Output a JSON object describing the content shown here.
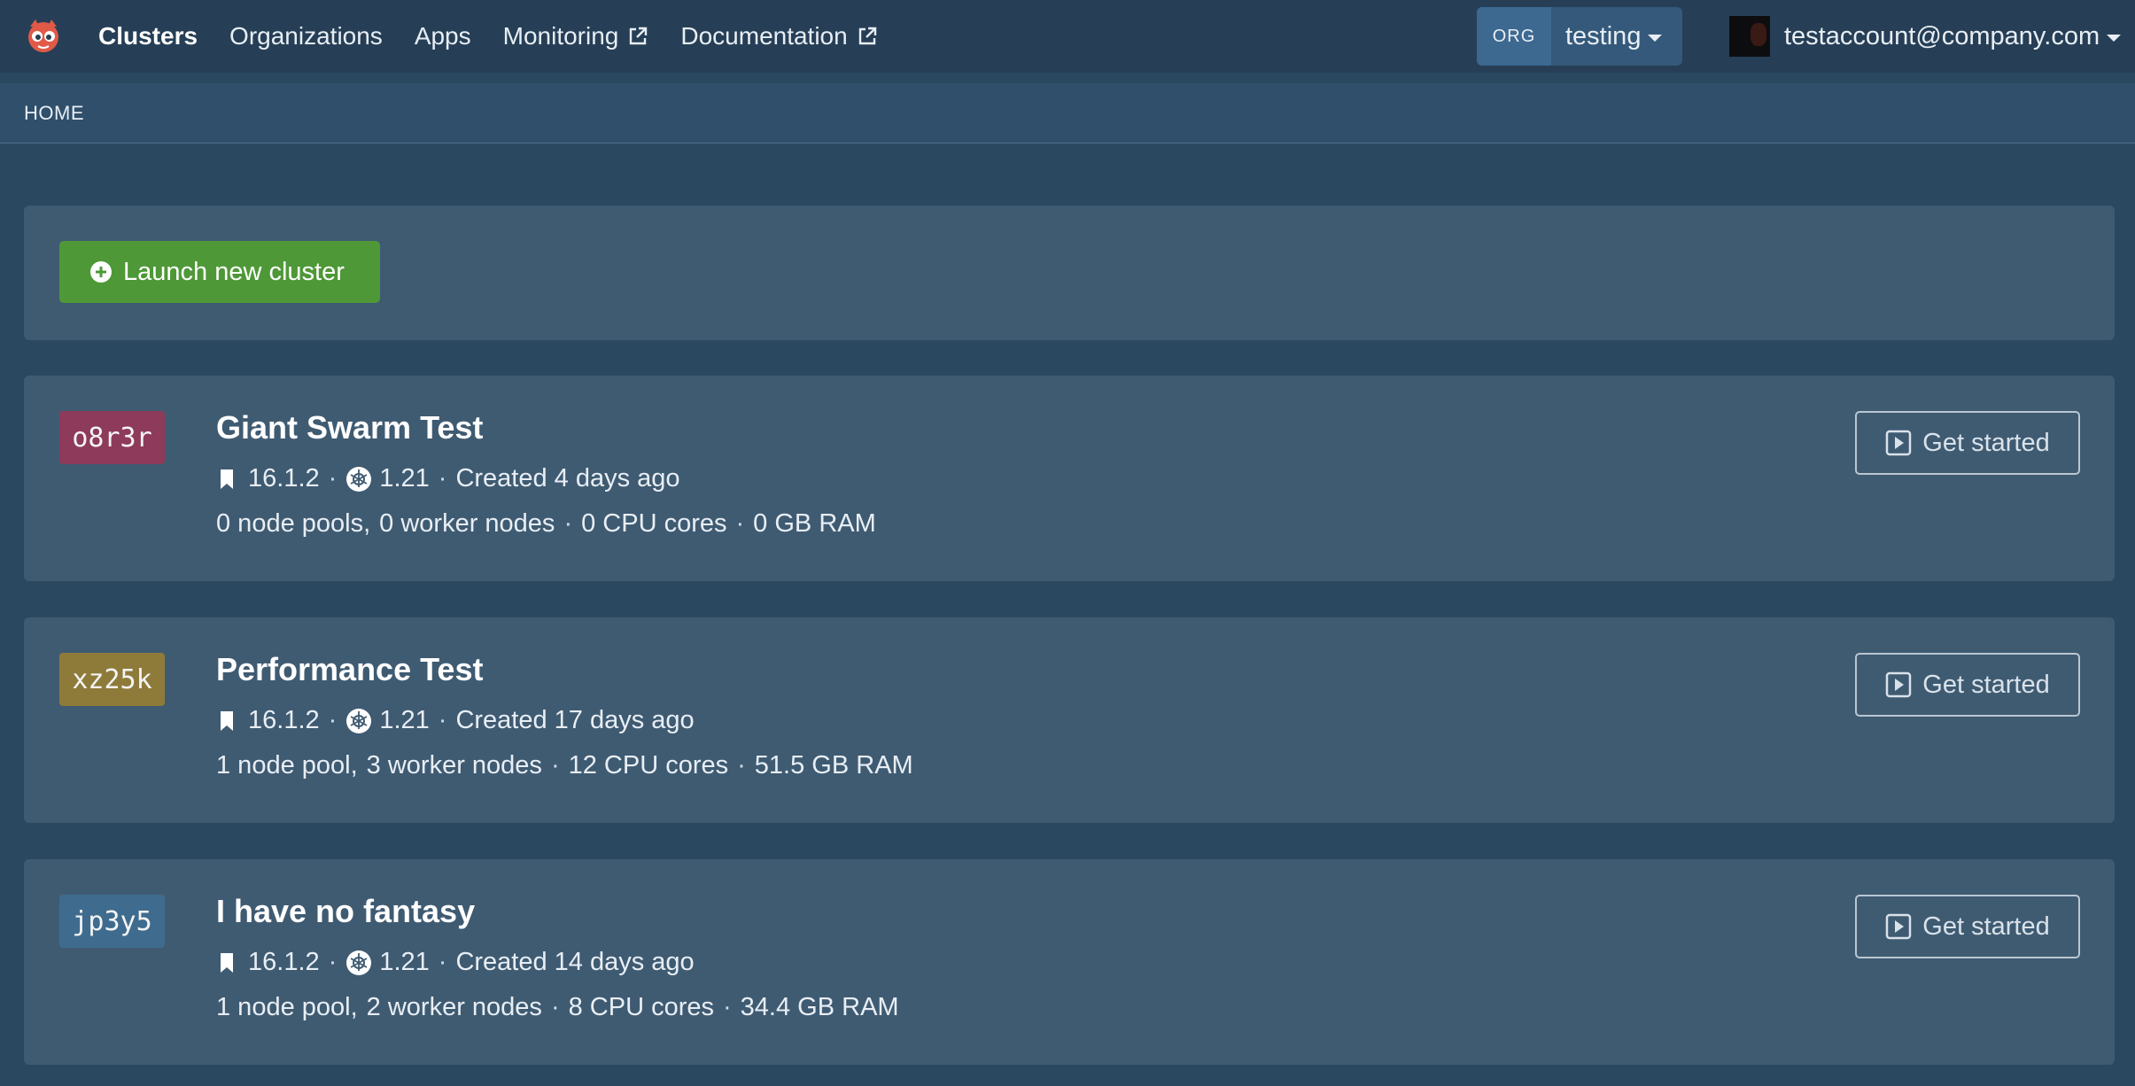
{
  "navbar": {
    "logo_icon": "giant-swarm-logo-icon",
    "links": [
      {
        "label": "Clusters",
        "active": true,
        "external": false
      },
      {
        "label": "Organizations",
        "active": false,
        "external": false
      },
      {
        "label": "Apps",
        "active": false,
        "external": false
      },
      {
        "label": "Monitoring",
        "active": false,
        "external": true
      },
      {
        "label": "Documentation",
        "active": false,
        "external": true
      }
    ],
    "org_badge": "ORG",
    "org_name": "testing",
    "user_email": "testaccount@company.com"
  },
  "breadcrumb": {
    "label": "HOME"
  },
  "launch": {
    "label": "Launch new cluster",
    "color": "#4e9837"
  },
  "clusters": [
    {
      "id": "o8r3r",
      "id_color": "#8e3a5a",
      "name": "Giant Swarm Test",
      "release": "16.1.2",
      "k8s": "1.21",
      "created": "Created 4 days ago",
      "node_pools": "0 node pools,",
      "worker_nodes": "0 worker nodes",
      "cpu": "0 CPU cores",
      "ram": "0 GB RAM",
      "action": "Get started"
    },
    {
      "id": "xz25k",
      "id_color": "#8e7b3a",
      "name": "Performance Test",
      "release": "16.1.2",
      "k8s": "1.21",
      "created": "Created 17 days ago",
      "node_pools": "1 node pool,",
      "worker_nodes": "3 worker nodes",
      "cpu": "12 CPU cores",
      "ram": "51.5 GB RAM",
      "action": "Get started"
    },
    {
      "id": "jp3y5",
      "id_color": "#3f6c8e",
      "name": "I have no fantasy",
      "release": "16.1.2",
      "k8s": "1.21",
      "created": "Created 14 days ago",
      "node_pools": "1 node pool,",
      "worker_nodes": "2 worker nodes",
      "cpu": "8 CPU cores",
      "ram": "34.4 GB RAM",
      "action": "Get started"
    }
  ]
}
